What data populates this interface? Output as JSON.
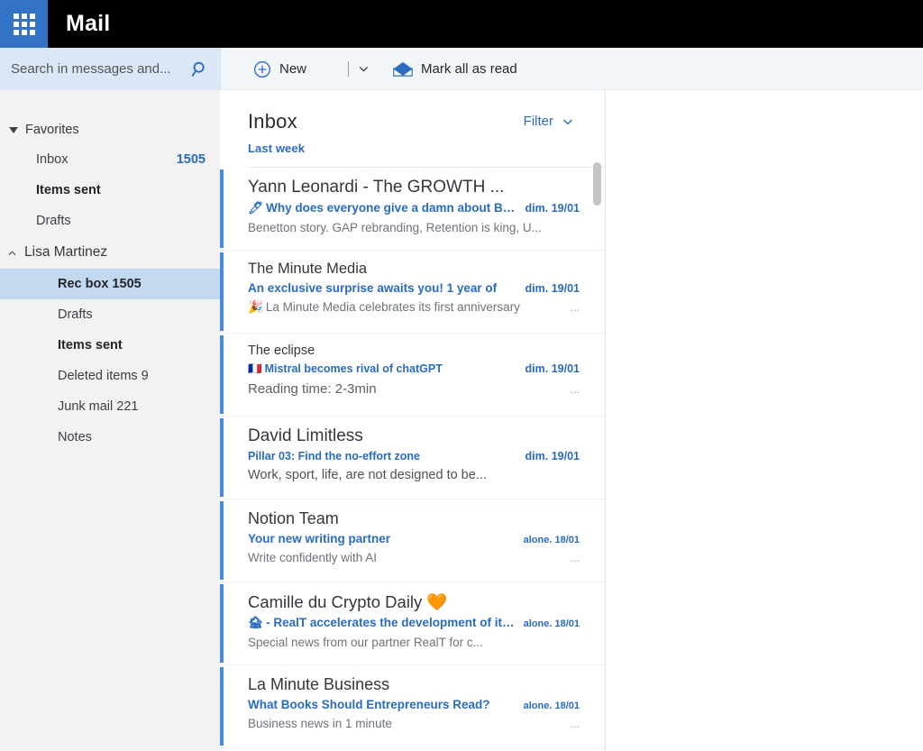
{
  "topbar": {
    "waffle_icon": "app-grid-icon",
    "title": "Mail"
  },
  "search": {
    "placeholder": "Search in messages and...",
    "value": "",
    "icon": "search-icon"
  },
  "toolbar": {
    "new_label": "New",
    "new_icon": "plus-circle-icon",
    "dropdown_icon": "chevron-down-icon",
    "mark_all_read_label": "Mark all as read",
    "mark_all_read_icon": "open-envelope-icon"
  },
  "sidebar": {
    "favorites": {
      "label": "Favorites",
      "collapse_icon": "triangle-down-icon",
      "items": [
        {
          "label": "Inbox",
          "count": "1505"
        },
        {
          "label": "Items sent",
          "count": ""
        },
        {
          "label": "Drafts",
          "count": ""
        }
      ]
    },
    "account": {
      "label": "Lisa Martinez",
      "collapse_icon": "chevron-up-icon",
      "items": [
        {
          "label": "Rec box 1505",
          "count": ""
        },
        {
          "label": "Drafts",
          "count": ""
        },
        {
          "label": "Items sent",
          "count": ""
        },
        {
          "label": "Deleted items 9",
          "count": ""
        },
        {
          "label": "Junk mail 221",
          "count": ""
        },
        {
          "label": "Notes",
          "count": ""
        }
      ]
    }
  },
  "list": {
    "title": "Inbox",
    "subtitle": "Last week",
    "filter_label": "Filter",
    "filter_icon": "chevron-down-icon",
    "messages": [
      {
        "sender": "Yann Leonardi - The GROWTH ...",
        "emoji": "🖊",
        "subject": "Why does everyone give a damn about Ben?",
        "date": "dim. 19/01",
        "preview": "Benetton story. GAP rebranding, Retention is king, U...",
        "preview_emoji": "",
        "dots": ""
      },
      {
        "sender": "The Minute Media",
        "emoji": "",
        "subject": "An exclusive surprise awaits you! 1 year of",
        "date": "dim. 19/01",
        "preview": "La Minute Media celebrates its first anniversary",
        "preview_emoji": "🎉",
        "dots": "..."
      },
      {
        "sender": "The eclipse",
        "emoji": "🇫🇷",
        "subject": "Mistral becomes rival of chatGPT",
        "date": "dim. 19/01",
        "preview": "Reading time: 2-3min",
        "preview_emoji": "",
        "dots": "..."
      },
      {
        "sender": "David Limitless",
        "emoji": "",
        "subject": "Pillar 03: Find the no-effort zone",
        "date": "dim. 19/01",
        "preview": "Work, sport, life, are not designed to be...",
        "preview_emoji": "",
        "dots": ""
      },
      {
        "sender": "Notion Team",
        "emoji": "",
        "subject": "Your new writing partner",
        "date": "alone. 18/01",
        "preview": "Write confidently with AI",
        "preview_emoji": "",
        "dots": "..."
      },
      {
        "sender": "Camille du Crypto Daily 🧡",
        "emoji": "🏚",
        "subject": "- RealT accelerates the development of its [",
        "date": "alone. 18/01",
        "preview": "Special news from our partner RealT for c...",
        "preview_emoji": "",
        "dots": ""
      },
      {
        "sender": "La Minute Business",
        "emoji": "",
        "subject": "What Books Should Entrepreneurs Read?",
        "date": "alone. 18/01",
        "preview": "Business news in 1 minute",
        "preview_emoji": "",
        "dots": "..."
      }
    ]
  },
  "colors": {
    "accent_blue": "#2a6bc2",
    "waffle_blue": "#3273c8",
    "unread_bar": "#4a89dc",
    "selected_row": "#c2d9ef",
    "search_bg": "#dbe7f4",
    "sidebar_bg": "#f2f2f2"
  }
}
